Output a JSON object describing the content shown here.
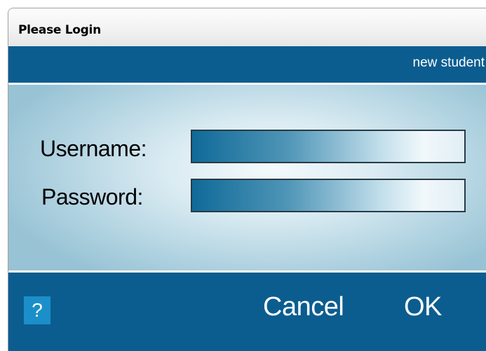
{
  "window": {
    "title": "Please Login"
  },
  "header": {
    "new_student_link": "new student"
  },
  "form": {
    "username_label": "Username:",
    "username_value": "",
    "password_label": "Password:",
    "password_value": ""
  },
  "footer": {
    "help_label": "?",
    "cancel_label": "Cancel",
    "ok_label": "OK"
  },
  "colors": {
    "band": "#0b5d8f",
    "help_button": "#1b8fc9",
    "text_on_band": "#ffffff"
  }
}
